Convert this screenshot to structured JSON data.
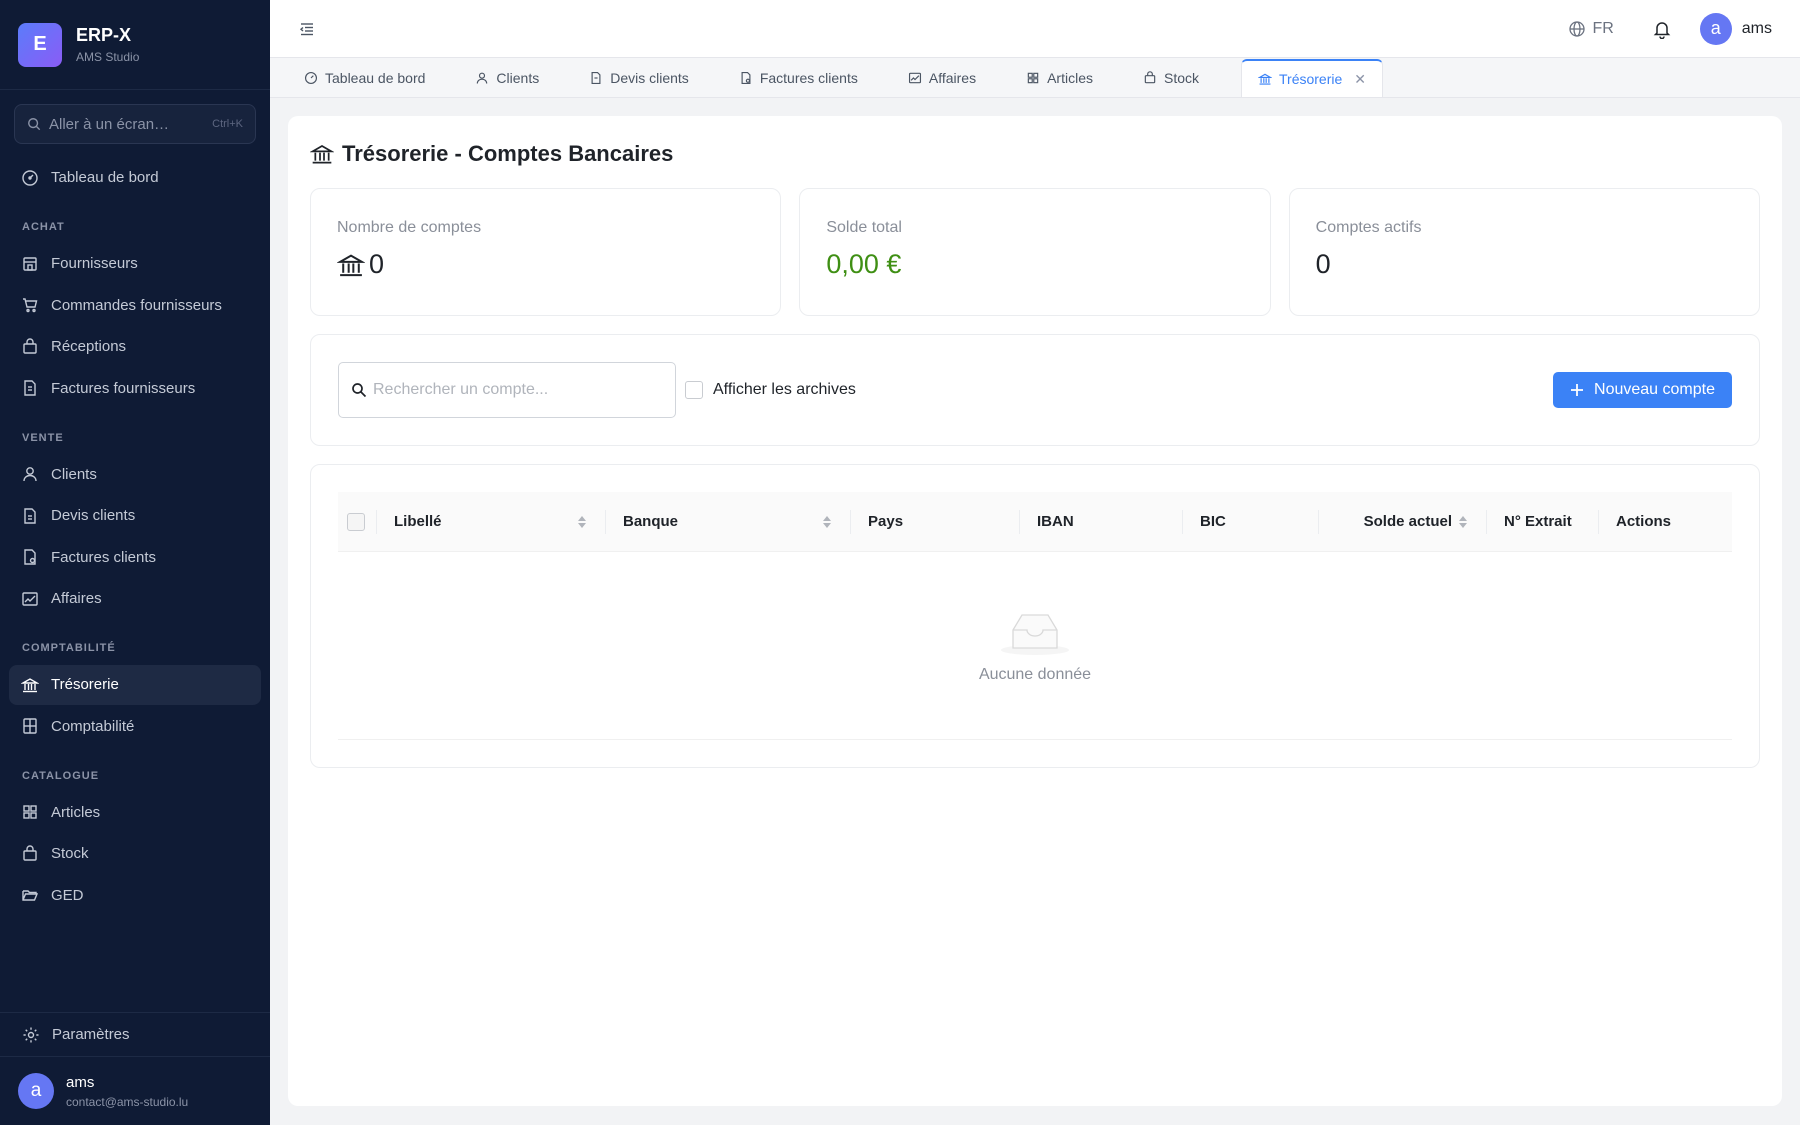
{
  "brand": {
    "logo_letter": "E",
    "name": "ERP-X",
    "subtitle": "AMS Studio"
  },
  "sidebar": {
    "search_placeholder": "Aller à un écran…",
    "search_shortcut": "Ctrl+K",
    "dashboard": "Tableau de bord",
    "sections": {
      "achat": "ACHAT",
      "vente": "VENTE",
      "compta": "COMPTABILITÉ",
      "catalogue": "CATALOGUE"
    },
    "achat_items": [
      "Fournisseurs",
      "Commandes fournisseurs",
      "Réceptions",
      "Factures fournisseurs"
    ],
    "vente_items": [
      "Clients",
      "Devis clients",
      "Factures clients",
      "Affaires"
    ],
    "compta_items": [
      "Trésorerie",
      "Comptabilité"
    ],
    "catalogue_items": [
      "Articles",
      "Stock",
      "GED"
    ],
    "settings": "Paramètres",
    "user": {
      "avatar": "a",
      "name": "ams",
      "email": "contact@ams-studio.lu"
    }
  },
  "topbar": {
    "lang": "FR",
    "user_avatar": "a",
    "user_name": "ams"
  },
  "tabs": [
    "Tableau de bord",
    "Clients",
    "Devis clients",
    "Factures clients",
    "Affaires",
    "Articles",
    "Stock",
    "Trésorerie"
  ],
  "page": {
    "title": "Trésorerie - Comptes Bancaires",
    "stats": [
      {
        "label": "Nombre de comptes",
        "value": "0"
      },
      {
        "label": "Solde total",
        "value": "0,00 €"
      },
      {
        "label": "Comptes actifs",
        "value": "0"
      }
    ],
    "search_placeholder": "Rechercher un compte...",
    "archives_label": "Afficher les archives",
    "new_button": "Nouveau compte",
    "columns": [
      "Libellé",
      "Banque",
      "Pays",
      "IBAN",
      "BIC",
      "Solde actuel",
      "N° Extrait",
      "Actions"
    ],
    "empty_text": "Aucune donnée"
  },
  "colors": {
    "sidebar_bg": "#0f1b35",
    "accent": "#3b82f6",
    "positive": "#3f8f14"
  }
}
